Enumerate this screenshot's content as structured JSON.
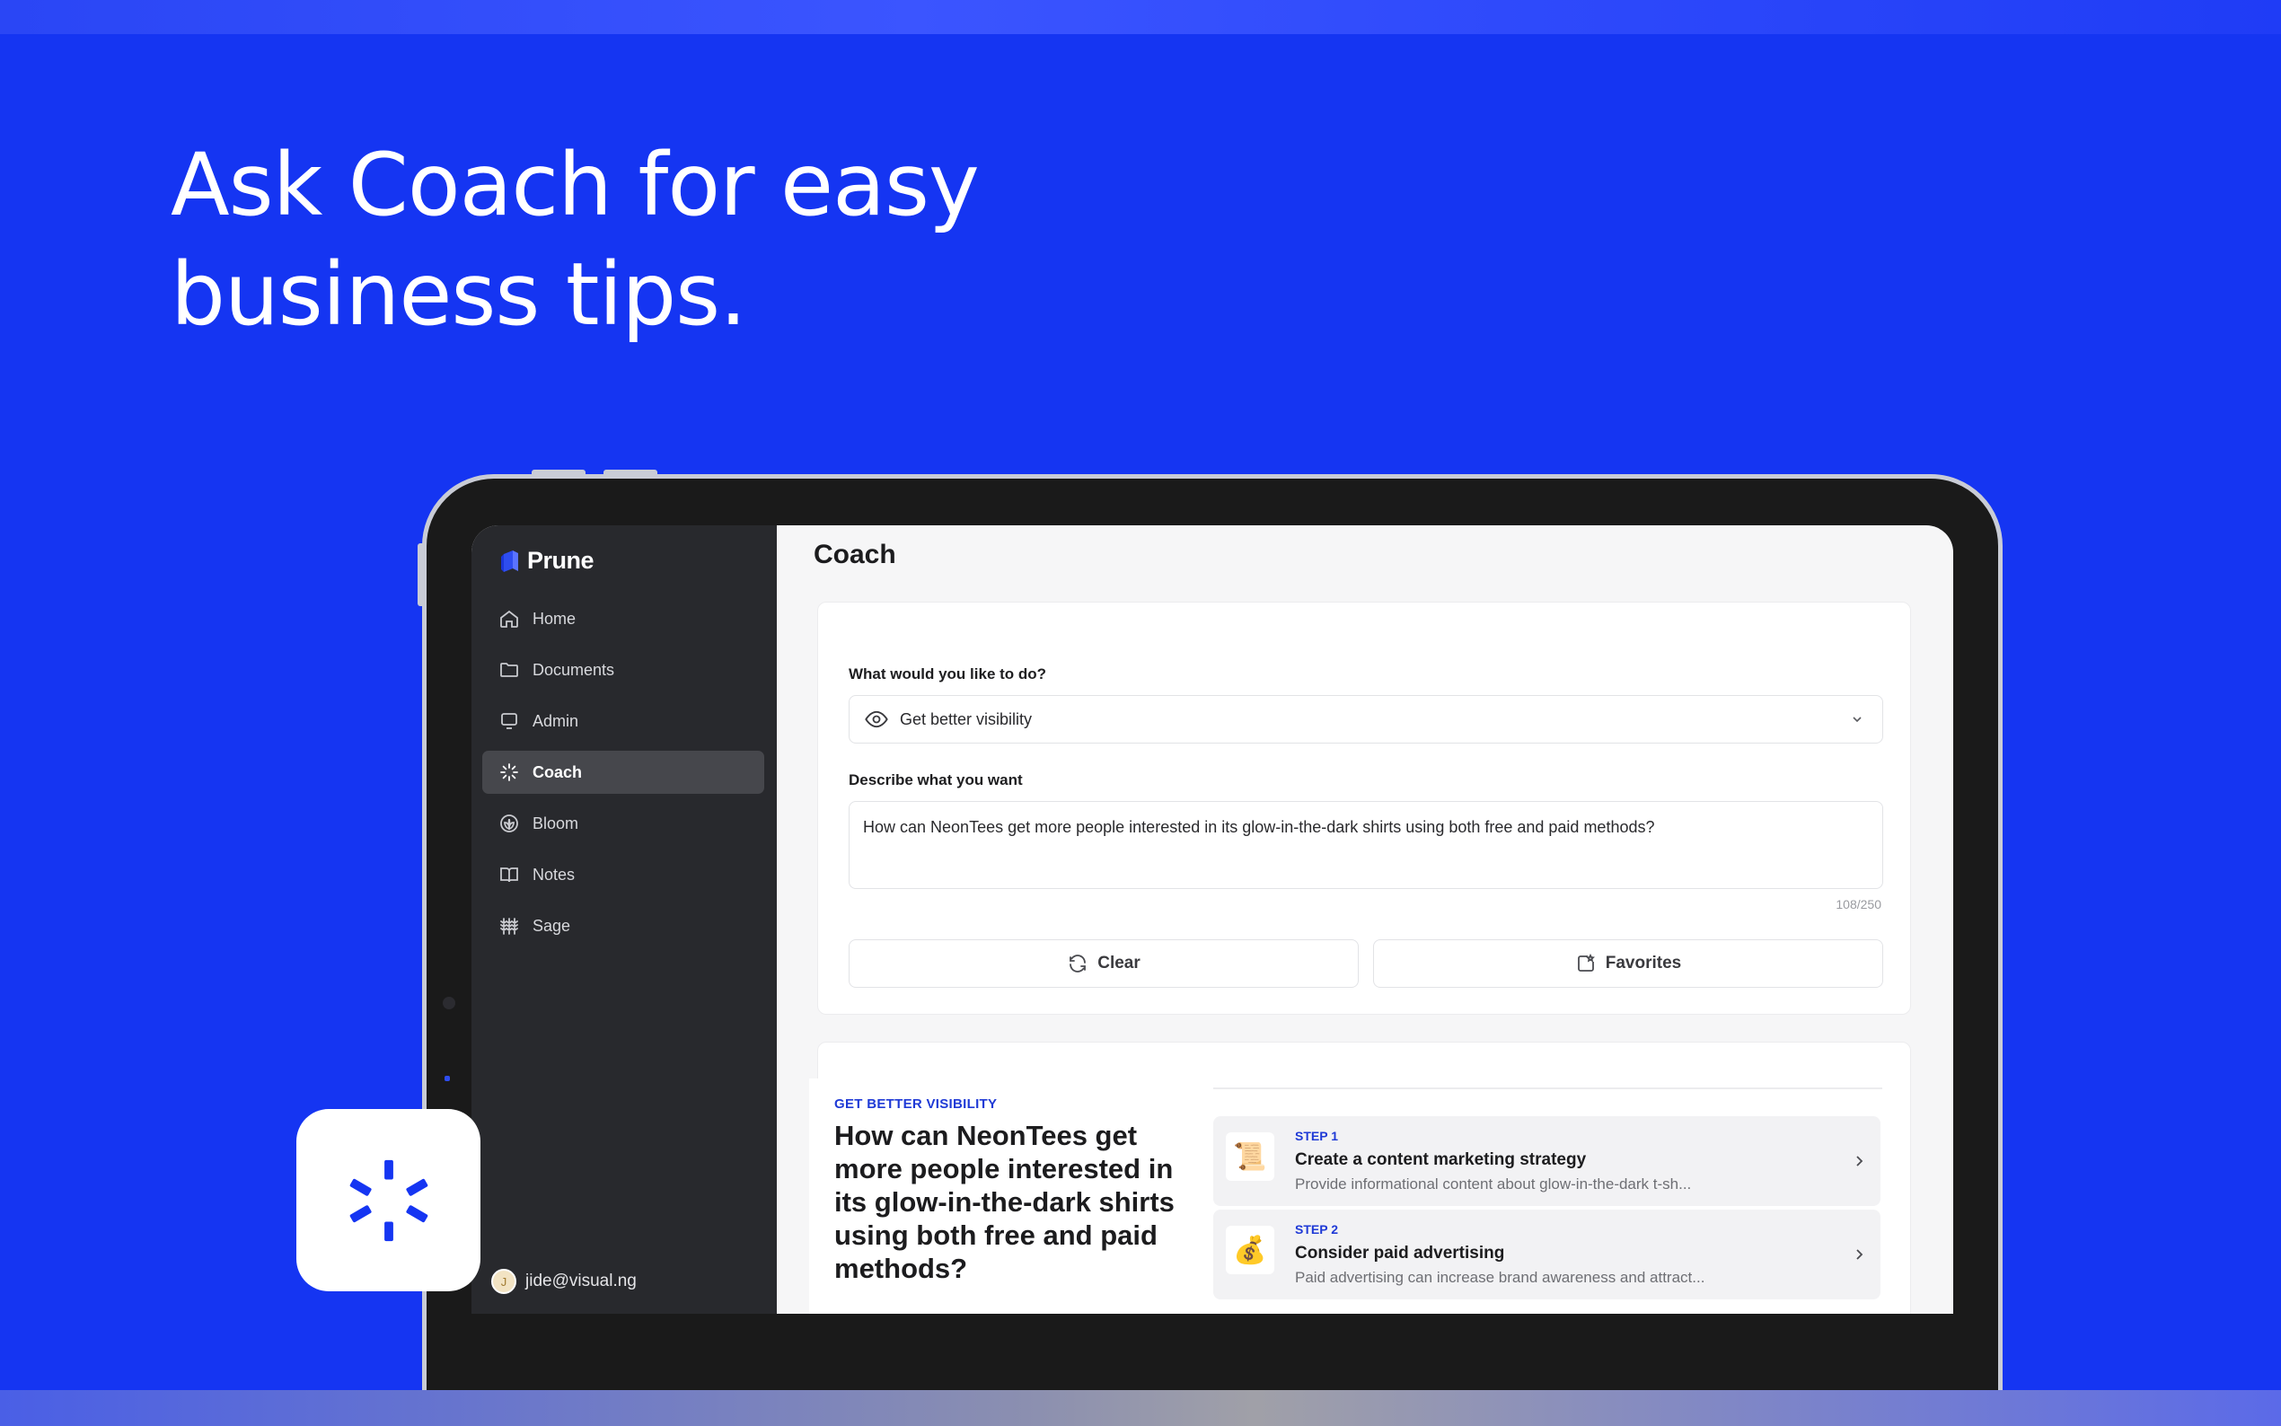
{
  "hero": {
    "line1": "Ask Coach for easy",
    "line2": "business tips."
  },
  "brand": {
    "name": "Prune",
    "accent": "#1535f2"
  },
  "sidebar": {
    "items": [
      {
        "label": "Home",
        "icon": "home-icon"
      },
      {
        "label": "Documents",
        "icon": "folder-icon"
      },
      {
        "label": "Admin",
        "icon": "monitor-icon"
      },
      {
        "label": "Coach",
        "icon": "sparkle-icon",
        "active": true
      },
      {
        "label": "Bloom",
        "icon": "flower-icon"
      },
      {
        "label": "Notes",
        "icon": "book-icon"
      },
      {
        "label": "Sage",
        "icon": "wheat-icon"
      }
    ],
    "user": {
      "initial": "J",
      "email": "jide@visual.ng"
    }
  },
  "main": {
    "title": "Coach",
    "form": {
      "goal_label": "What would you like to do?",
      "goal_value": "Get better visibility",
      "describe_label": "Describe what you want",
      "describe_value": "How can NeonTees get more people interested in its glow-in-the-dark shirts using both free and paid methods?",
      "counter": "108/250",
      "clear_label": "Clear",
      "favorites_label": "Favorites"
    },
    "result": {
      "tag": "GET BETTER VISIBILITY",
      "question": "How can NeonTees get more people interested in its glow-in-the-dark shirts using both free and paid methods?",
      "steps": [
        {
          "num": "STEP 1",
          "title": "Create a content marketing strategy",
          "desc": "Provide informational content about glow-in-the-dark t-sh...",
          "emoji": "📜"
        },
        {
          "num": "STEP 2",
          "title": "Consider paid advertising",
          "desc": "Paid advertising can increase brand awareness and attract...",
          "emoji": "💰"
        }
      ]
    }
  }
}
